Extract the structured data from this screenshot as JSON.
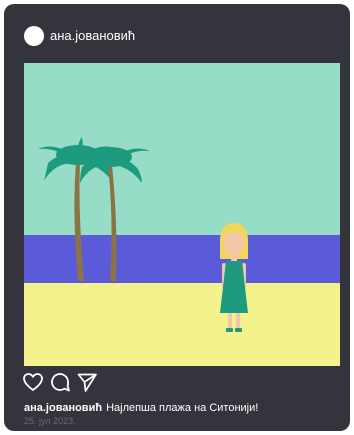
{
  "post": {
    "username": "ана.јовановић",
    "caption_text": "Најлепша плажа на Ситонији!",
    "date": "25. јул 2023."
  },
  "icons": {
    "avatar": "avatar-circle",
    "like": "heart-icon",
    "comment": "comment-icon",
    "share": "send-icon"
  },
  "colors": {
    "card_background": "#33343c",
    "sky": "#97dcc6",
    "sea": "#5b5bd9",
    "sand": "#f3f28d",
    "palm_leaves": "#1e9a7e",
    "palm_trunk": "#8a7446",
    "dress": "#1e9a7e",
    "hair": "#f2d65b"
  }
}
